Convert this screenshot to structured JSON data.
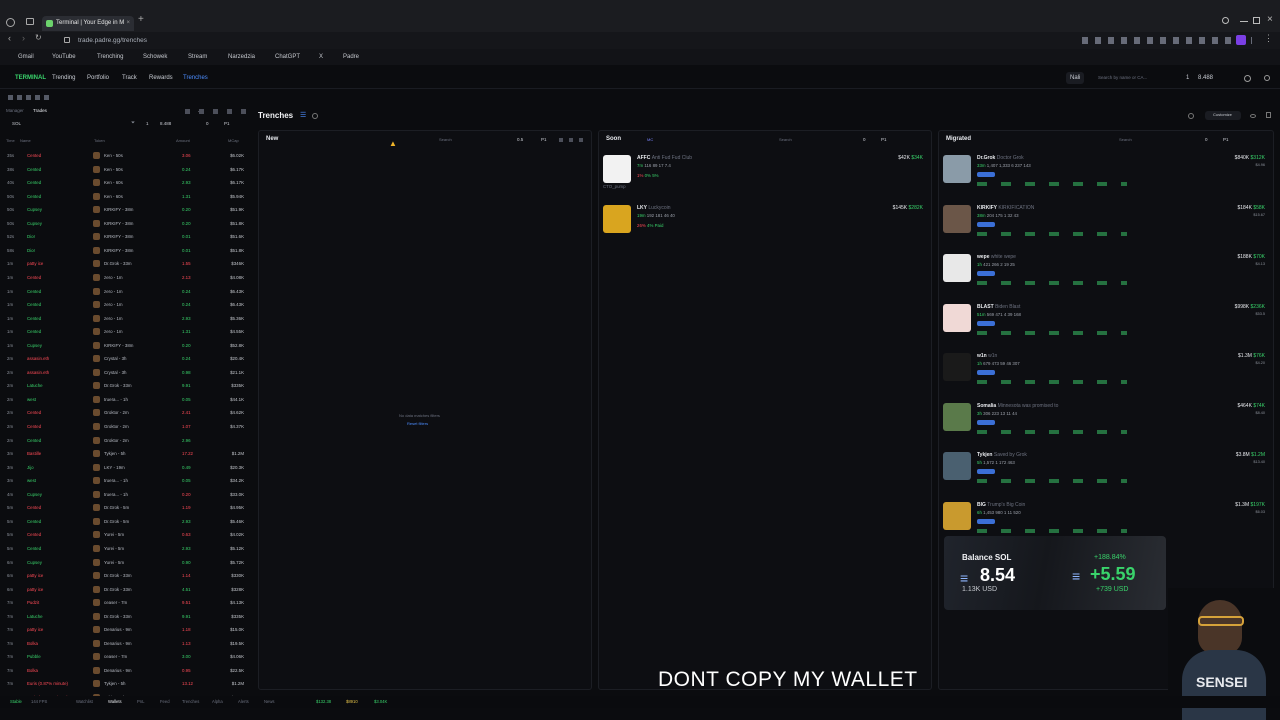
{
  "browser": {
    "tab_title": "Terminal | Your Edge in M",
    "url": "trade.padre.gg/trenches",
    "bookmarks": [
      "Gmail",
      "YouTube",
      "Trenching",
      "Schowek",
      "Stream",
      "Narzedzia",
      "ChatGPT",
      "X",
      "Padre"
    ]
  },
  "app_nav": {
    "brand": "TERMINAL",
    "items": [
      "Trending",
      "Portfolio",
      "Track",
      "Rewards",
      "Trenches"
    ],
    "active": "Trenches",
    "wallet_label": "Nali",
    "search_placeholder": "Search by name or CA...",
    "counter": "1",
    "sol_value": "8.488"
  },
  "left_panel": {
    "tabs": [
      "Manager",
      "Trades"
    ],
    "active_tab": "Trades",
    "chain": "SOL",
    "filter_count": "1",
    "filter_value": "8.488",
    "filter_zero": "0",
    "preset": "P1",
    "columns": [
      "Time",
      "Name",
      "Token",
      "Amount",
      "MCap"
    ],
    "rows": [
      {
        "time": "35s",
        "type": "Cented",
        "type_color": "red",
        "token": "Ken - 50s",
        "amount": "3.06",
        "amount_color": "red",
        "mcap": "$6.02K"
      },
      {
        "time": "38s",
        "type": "Cented",
        "type_color": "green",
        "token": "Ken - 50s",
        "amount": "0.24",
        "amount_color": "green",
        "mcap": "$6.17K"
      },
      {
        "time": "40s",
        "type": "Cented",
        "type_color": "green",
        "token": "Ken - 60s",
        "amount": "2.93",
        "amount_color": "green",
        "mcap": "$6.17K"
      },
      {
        "time": "50s",
        "type": "Cented",
        "type_color": "green",
        "token": "Ken - 60s",
        "amount": "1.31",
        "amount_color": "green",
        "mcap": "$5.94K"
      },
      {
        "time": "50s",
        "type": "Cupsey",
        "type_color": "green",
        "token": "KIRKIFY - 38m",
        "amount": "0.20",
        "amount_color": "green",
        "mcap": "$51.9K"
      },
      {
        "time": "50s",
        "type": "Cupsey",
        "type_color": "green",
        "token": "KIRKIFY - 38m",
        "amount": "0.20",
        "amount_color": "green",
        "mcap": "$51.8K"
      },
      {
        "time": "52s",
        "type": "Dior",
        "type_color": "green",
        "token": "KIRKIFY - 38m",
        "amount": "0.01",
        "amount_color": "green",
        "mcap": "$51.6K"
      },
      {
        "time": "58s",
        "type": "Dior",
        "type_color": "green",
        "token": "KIRKIFY - 38m",
        "amount": "0.01",
        "amount_color": "green",
        "mcap": "$51.8K"
      },
      {
        "time": "1m",
        "type": "patty ice",
        "type_color": "red",
        "token": "Dr.Grok - 33m",
        "amount": "1.55",
        "amount_color": "red",
        "mcap": "$346K"
      },
      {
        "time": "1m",
        "type": "Cented",
        "type_color": "red",
        "token": "zero - 1m",
        "amount": "2.13",
        "amount_color": "red",
        "mcap": "$4.08K"
      },
      {
        "time": "1m",
        "type": "Cented",
        "type_color": "green",
        "token": "zero - 1m",
        "amount": "0.24",
        "amount_color": "green",
        "mcap": "$6.43K"
      },
      {
        "time": "1m",
        "type": "Cented",
        "type_color": "green",
        "token": "zero - 1m",
        "amount": "0.24",
        "amount_color": "green",
        "mcap": "$6.43K"
      },
      {
        "time": "1m",
        "type": "Cented",
        "type_color": "green",
        "token": "zero - 1m",
        "amount": "2.93",
        "amount_color": "green",
        "mcap": "$5.36K"
      },
      {
        "time": "1m",
        "type": "Cented",
        "type_color": "green",
        "token": "zero - 1m",
        "amount": "1.31",
        "amount_color": "green",
        "mcap": "$4.55K"
      },
      {
        "time": "1m",
        "type": "Cupsey",
        "type_color": "green",
        "token": "KIRKIFY - 38m",
        "amount": "0.20",
        "amount_color": "green",
        "mcap": "$52.8K"
      },
      {
        "time": "2m",
        "type": "assasin.eth",
        "type_color": "red",
        "token": "Crystal - 3h",
        "amount": "0.24",
        "amount_color": "green",
        "mcap": "$20.4K"
      },
      {
        "time": "2m",
        "type": "assasin.eth",
        "type_color": "red",
        "token": "Crystal - 3h",
        "amount": "0.98",
        "amount_color": "green",
        "mcap": "$21.1K"
      },
      {
        "time": "2m",
        "type": "Latuche",
        "type_color": "green",
        "token": "Dr.Grok - 33m",
        "amount": "9.91",
        "amount_color": "green",
        "mcap": "$335K"
      },
      {
        "time": "2m",
        "type": "west",
        "type_color": "green",
        "token": "truera... - 1h",
        "amount": "0.05",
        "amount_color": "green",
        "mcap": "$44.1K"
      },
      {
        "time": "2m",
        "type": "Cented",
        "type_color": "red",
        "token": "Groktor - 2m",
        "amount": "2.41",
        "amount_color": "red",
        "mcap": "$4.62K"
      },
      {
        "time": "2m",
        "type": "Cented",
        "type_color": "red",
        "token": "Groktor - 2m",
        "amount": "1.07",
        "amount_color": "red",
        "mcap": "$4.37K"
      },
      {
        "time": "2m",
        "type": "Cented",
        "type_color": "green",
        "token": "Groktor - 2m",
        "amount": "2.96",
        "amount_color": "green",
        "mcap": ""
      },
      {
        "time": "3m",
        "type": "Bastille",
        "type_color": "red",
        "token": "Tykjen - 5h",
        "amount": "17.22",
        "amount_color": "red",
        "mcap": "$1.2M"
      },
      {
        "time": "3m",
        "type": "Jijo",
        "type_color": "green",
        "token": "LKY - 19m",
        "amount": "0.49",
        "amount_color": "green",
        "mcap": "$20.3K"
      },
      {
        "time": "3m",
        "type": "west",
        "type_color": "green",
        "token": "truera... - 1h",
        "amount": "0.05",
        "amount_color": "green",
        "mcap": "$34.2K"
      },
      {
        "time": "4m",
        "type": "Cupsey",
        "type_color": "green",
        "token": "truera... - 1h",
        "amount": "0.20",
        "amount_color": "red",
        "mcap": "$33.0K"
      },
      {
        "time": "5m",
        "type": "Cented",
        "type_color": "red",
        "token": "Dr.Grok - 5m",
        "amount": "1.19",
        "amount_color": "red",
        "mcap": "$4.95K"
      },
      {
        "time": "5m",
        "type": "Cented",
        "type_color": "green",
        "token": "Dr.Grok - 5m",
        "amount": "2.93",
        "amount_color": "green",
        "mcap": "$5.46K"
      },
      {
        "time": "5m",
        "type": "Cented",
        "type_color": "red",
        "token": "Yurei - 5m",
        "amount": "0.63",
        "amount_color": "red",
        "mcap": "$4.02K"
      },
      {
        "time": "5m",
        "type": "Cented",
        "type_color": "green",
        "token": "Yurei - 5m",
        "amount": "2.93",
        "amount_color": "green",
        "mcap": "$5.12K"
      },
      {
        "time": "6m",
        "type": "Cupsey",
        "type_color": "green",
        "token": "Yurei - 5m",
        "amount": "0.90",
        "amount_color": "green",
        "mcap": "$5.72K"
      },
      {
        "time": "6m",
        "type": "patty ice",
        "type_color": "red",
        "token": "Dr.Grok - 33m",
        "amount": "1.14",
        "amount_color": "red",
        "mcap": "$330K"
      },
      {
        "time": "6m",
        "type": "patty ice",
        "type_color": "red",
        "token": "Dr.Grok - 33m",
        "amount": "4.51",
        "amount_color": "green",
        "mcap": "$328K"
      },
      {
        "time": "7m",
        "type": "Pudzit",
        "type_color": "red",
        "token": "ceaser - 7m",
        "amount": "9.51",
        "amount_color": "red",
        "mcap": "$4.13K"
      },
      {
        "time": "7m",
        "type": "Latuche",
        "type_color": "green",
        "token": "Dr.Grok - 33m",
        "amount": "9.91",
        "amount_color": "green",
        "mcap": "$335K"
      },
      {
        "time": "7m",
        "type": "patty ice",
        "type_color": "red",
        "token": "Denarius - 9m",
        "amount": "1.18",
        "amount_color": "red",
        "mcap": "$15.0K"
      },
      {
        "time": "7m",
        "type": "Bolka",
        "type_color": "red",
        "token": "Denarius - 9m",
        "amount": "1.13",
        "amount_color": "red",
        "mcap": "$19.5K"
      },
      {
        "time": "7m",
        "type": "Pubble",
        "type_color": "green",
        "token": "ceaser - 7m",
        "amount": "3.00",
        "amount_color": "green",
        "mcap": "$4.06K"
      },
      {
        "time": "7m",
        "type": "Bolka",
        "type_color": "red",
        "token": "Denarius - 9m",
        "amount": "0.95",
        "amount_color": "red",
        "mcap": "$22.5K"
      },
      {
        "time": "7m",
        "type": "Euris (0.87% minute)",
        "type_color": "red",
        "token": "Tykjen - 5h",
        "amount": "13.12",
        "amount_color": "red",
        "mcap": "$1.2M"
      },
      {
        "time": "7m",
        "type": "Euris (0.87% minute)",
        "type_color": "red",
        "token": "Tykjen - 5h",
        "amount": "1.53",
        "amount_color": "red",
        "mcap": "$991K"
      }
    ]
  },
  "trenches": {
    "title": "Trenches",
    "new": {
      "title": "New",
      "search_placeholder": "Search",
      "filter_value": "0.5",
      "preset": "P1",
      "empty_message": "No data matches filters",
      "reset_label": "Reset filters"
    },
    "soon": {
      "title": "Soon",
      "tag": "MC",
      "search_placeholder": "Search",
      "filter_value": "0",
      "preset": "P1",
      "cards": [
        {
          "ticker": "AFFC",
          "name": "Anti Fud Fud Club",
          "age": "7m",
          "stats": "116  89  17  7.4",
          "mc": "$42K",
          "mc_delta": "$34K",
          "source": "CTO_pump",
          "avatar_color": "#f2f2f2",
          "pct": "1%",
          "pct2": "0%",
          "pct3": "5%"
        },
        {
          "ticker": "LKY",
          "name": "Luckycoin",
          "age": "19m",
          "stats": "192  181  46  40",
          "mc": "$145K",
          "mc_delta": "$282K",
          "source": "",
          "avatar_color": "#d9a51f",
          "pct": "26%",
          "pct2": "4%",
          "pct3": "Paid"
        }
      ]
    },
    "migrated": {
      "title": "Migrated",
      "search_placeholder": "Search",
      "filter_value": "0",
      "preset": "P1",
      "cards": [
        {
          "ticker": "Dr.Grok",
          "name": "Doctor Grok",
          "age": "33m",
          "stats": "1,407  1,333  6  237  143",
          "mc": "$840K",
          "mc_delta": "$312K",
          "sub": "$4.96",
          "avatar_color": "#8a9ba8"
        },
        {
          "ticker": "KIRKIFY",
          "name": "KIRKIFICATION",
          "age": "38m",
          "stats": "204  175  1  32  43",
          "mc": "$184K",
          "mc_delta": "$58K",
          "sub": "$15.67",
          "avatar_color": "#6b5648"
        },
        {
          "ticker": "wepe",
          "name": "white wepe",
          "age": "1h",
          "stats": "421  266  2  19  25",
          "mc": "$188K",
          "mc_delta": "$70K",
          "sub": "$4.13",
          "avatar_color": "#e8e8e8"
        },
        {
          "ticker": "BLAST",
          "name": "Biden Blast",
          "age": "51m",
          "stats": "569  471  4  39  168",
          "mc": "$998K",
          "mc_delta": "$236K",
          "sub": "$53.5",
          "avatar_color": "#f0d9d6"
        },
        {
          "ticker": "w1n",
          "name": "w1n",
          "age": "1h",
          "stats": "679  473  59  46  307",
          "mc": "$1.3M",
          "mc_delta": "$76K",
          "sub": "$4.20",
          "avatar_color": "#1a1a1a"
        },
        {
          "ticker": "Somalia",
          "name": "Minnesota was promised to",
          "age": "3h",
          "stats": "306  223  13  11  44",
          "mc": "$464K",
          "mc_delta": "$74K",
          "sub": "$8.40",
          "avatar_color": "#5a7a4a"
        },
        {
          "ticker": "Tykjen",
          "name": "Saved by Grok",
          "age": "5h",
          "stats": "1,572  1  172  463",
          "mc": "$3.8M",
          "mc_delta": "$1.2M",
          "sub": "$13.40",
          "avatar_color": "#4a6070"
        },
        {
          "ticker": "BIG",
          "name": "Trump's Big Coin",
          "age": "6h",
          "stats": "1,453  980  1  11  520",
          "mc": "$1.3M",
          "mc_delta": "$197K",
          "sub": "$6.03",
          "avatar_color": "#c99a2e"
        }
      ]
    }
  },
  "balance": {
    "label": "Balance SOL",
    "value": "8.54",
    "usd": "1.13K USD",
    "pnl_pct": "+188.84%",
    "pnl_sol": "+5.59",
    "pnl_usd": "+739 USD"
  },
  "caption": "DONT COPY MY WALLET",
  "webcam_name": "SENSEI",
  "status_bar": {
    "items": [
      "Stable",
      "144 FPS",
      "Watchlist",
      "Wallets",
      "PnL",
      "Feed",
      "Trenches",
      "Alpha",
      "Alerts",
      "News"
    ],
    "sol_price": "$132.38",
    "eth_price": "$8910",
    "third_price": "$3.04K"
  },
  "colors": {
    "green": "#39d36b",
    "red": "#ff4b57",
    "blue": "#4c8dff",
    "bg": "#0b0c0f"
  }
}
